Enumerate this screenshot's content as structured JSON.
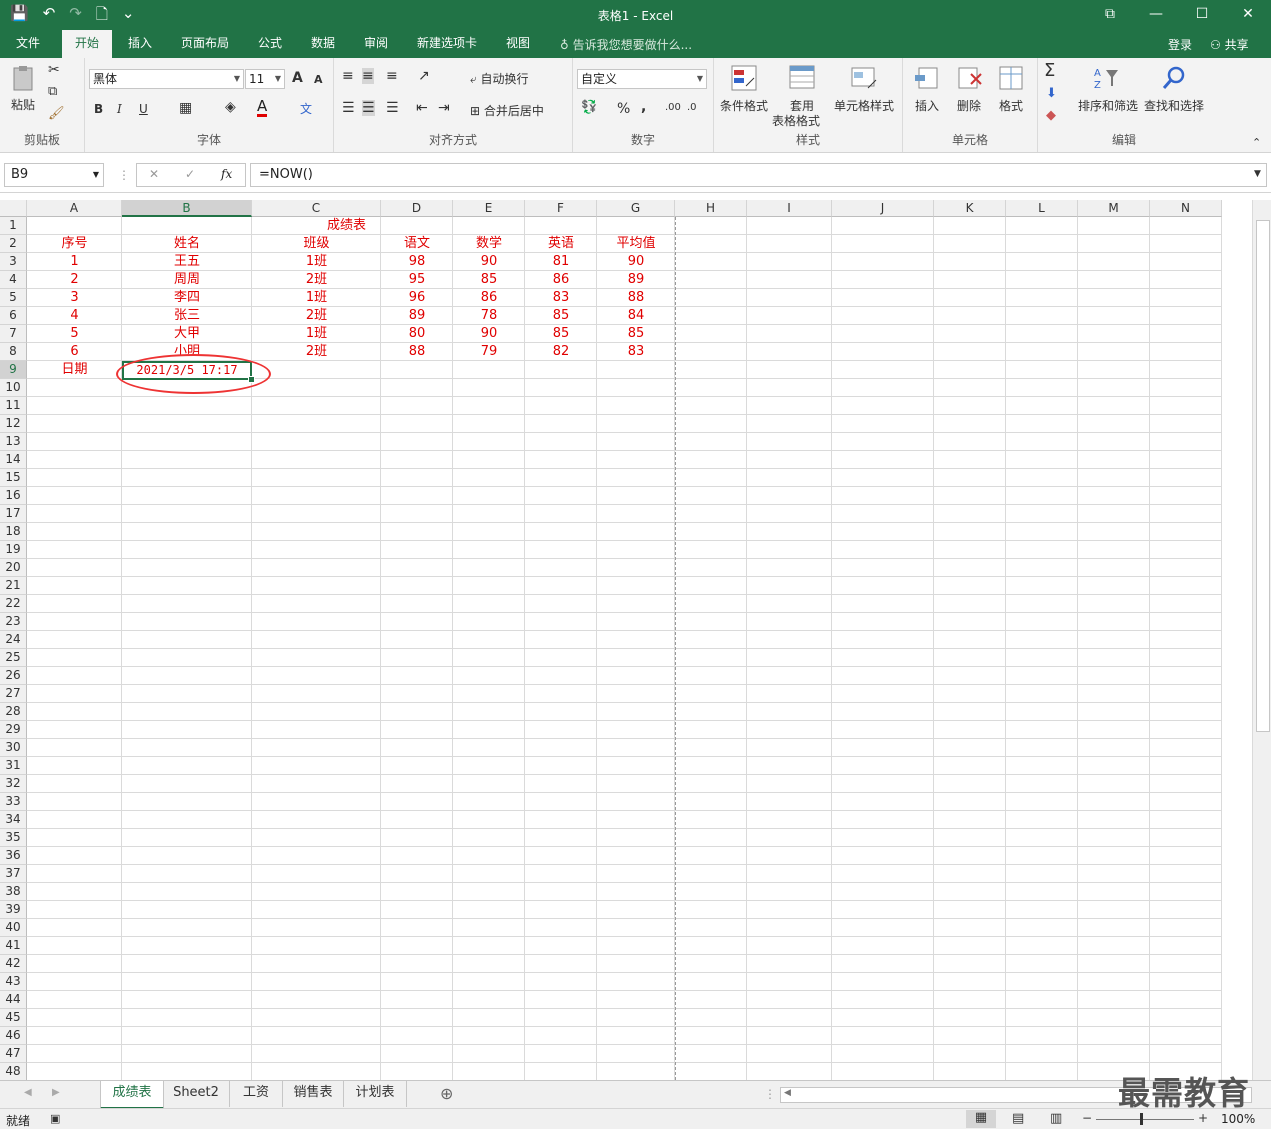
{
  "window": {
    "title": "表格1 - Excel",
    "minimize": "—",
    "restore": "❐",
    "maximize": "☐",
    "close": "✕",
    "ribbon_display": "⧉"
  },
  "qat": {
    "save": "💾",
    "undo": "↶",
    "redo": "↷",
    "new": "🗋",
    "customize": "⌄"
  },
  "tabs": [
    "文件",
    "开始",
    "插入",
    "页面布局",
    "公式",
    "数据",
    "审阅",
    "新建选项卡",
    "视图"
  ],
  "tell_me": "告诉我您想要做什么...",
  "login": "登录",
  "share": "共享",
  "ribbon": {
    "clipboard": {
      "paste": "粘贴",
      "label": "剪贴板"
    },
    "font": {
      "name": "黑体",
      "size": "11",
      "bold": "B",
      "italic": "I",
      "underline": "U",
      "grow": "A",
      "shrink": "A",
      "color_a": "A",
      "label": "字体"
    },
    "align": {
      "wrap": "自动换行",
      "merge": "合并后居中",
      "label": "对齐方式"
    },
    "number": {
      "format": "自定义",
      "percent": "%",
      "comma": ",",
      "label": "数字"
    },
    "styles": {
      "conditional": "条件格式",
      "table1": "套用",
      "table2": "表格格式",
      "cell": "单元格样式",
      "label": "样式"
    },
    "cells": {
      "insert": "插入",
      "delete": "删除",
      "format": "格式",
      "label": "单元格"
    },
    "editing": {
      "sum": "Σ",
      "sort": "排序和筛选",
      "find": "查找和选择",
      "label": "编辑"
    }
  },
  "formula_bar": {
    "name_box": "B9",
    "cancel": "✕",
    "enter": "✓",
    "fx": "fx",
    "formula": "=NOW()"
  },
  "columns": [
    "A",
    "B",
    "C",
    "D",
    "E",
    "F",
    "G",
    "H",
    "I",
    "J",
    "K",
    "L",
    "M",
    "N"
  ],
  "selected_column": "B",
  "selected_row": 9,
  "sheet": {
    "title": "成绩表",
    "headers": [
      "序号",
      "姓名",
      "班级",
      "语文",
      "数学",
      "英语",
      "平均值"
    ],
    "rows": [
      [
        "1",
        "王五",
        "1班",
        "98",
        "90",
        "81",
        "90"
      ],
      [
        "2",
        "周周",
        "2班",
        "95",
        "85",
        "86",
        "89"
      ],
      [
        "3",
        "李四",
        "1班",
        "96",
        "86",
        "83",
        "88"
      ],
      [
        "4",
        "张三",
        "2班",
        "89",
        "78",
        "85",
        "84"
      ],
      [
        "5",
        "大甲",
        "1班",
        "80",
        "90",
        "85",
        "85"
      ],
      [
        "6",
        "小明",
        "2班",
        "88",
        "79",
        "82",
        "83"
      ]
    ],
    "date_label": "日期",
    "date_value": "2021/3/5  17:17"
  },
  "sheet_tabs": [
    "成绩表",
    "Sheet2",
    "工资",
    "销售表",
    "计划表"
  ],
  "add_sheet": "⊕",
  "status": {
    "ready": "就绪",
    "zoom": "100%"
  },
  "watermark": "最需教育",
  "colors": {
    "accent": "#217346",
    "cell_text": "#e00000",
    "annotation": "#e33333"
  }
}
